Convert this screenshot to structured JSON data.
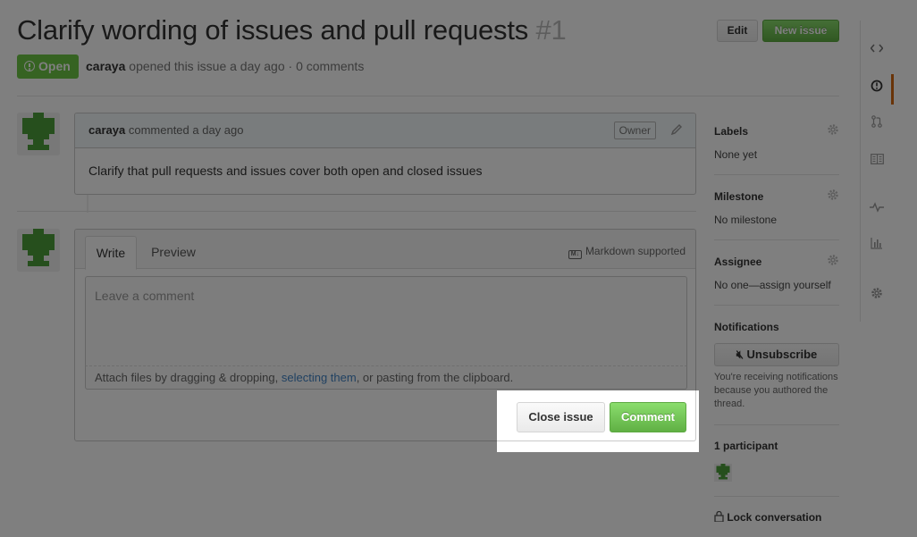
{
  "issue": {
    "title": "Clarify wording of issues and pull requests",
    "number": "#1",
    "state": "Open",
    "author": "caraya",
    "meta_text": "opened this issue a day ago · 0 comments"
  },
  "header_buttons": {
    "edit": "Edit",
    "new_issue": "New issue"
  },
  "comment": {
    "author": "caraya",
    "time_text": "commented a day ago",
    "owner_tag": "Owner",
    "body": "Clarify that pull requests and issues cover both open and closed issues"
  },
  "composer": {
    "tabs": [
      "Write",
      "Preview"
    ],
    "markdown_hint": "Markdown supported",
    "placeholder": "Leave a comment",
    "attach_prefix": "Attach files by dragging & dropping, ",
    "attach_link": "selecting them",
    "attach_suffix": ", or pasting from the clipboard.",
    "close_button": "Close issue",
    "comment_button": "Comment"
  },
  "sidebar": {
    "labels": {
      "title": "Labels",
      "value": "None yet"
    },
    "milestone": {
      "title": "Milestone",
      "value": "No milestone"
    },
    "assignee": {
      "title": "Assignee",
      "value": "No one—assign yourself"
    },
    "notifications": {
      "title": "Notifications",
      "button": "Unsubscribe",
      "note": "You're receiving notifications because you authored the thread."
    },
    "participants": {
      "title": "1 participant"
    },
    "lock": "Lock conversation"
  },
  "repo_nav_icons": [
    "code-icon",
    "issues-icon",
    "pull-request-icon",
    "wiki-icon",
    "pulse-icon",
    "graphs-icon",
    "settings-icon"
  ],
  "colors": {
    "open_green": "#6cc644",
    "button_green": "#60b044",
    "link_blue": "#4183c4",
    "active_nav": "#d26911",
    "overlay_dim": "rgba(0,0,0,0.5)"
  }
}
